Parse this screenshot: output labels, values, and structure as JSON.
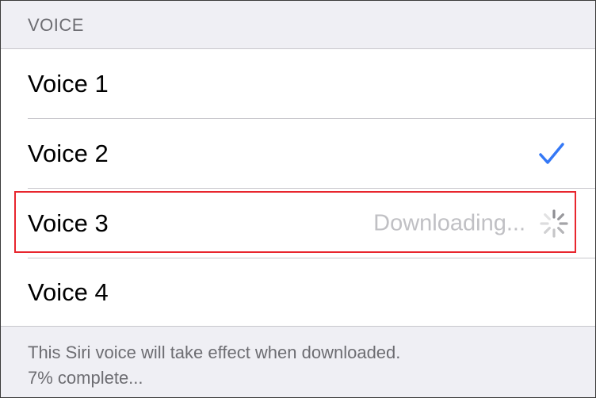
{
  "section": {
    "title": "VOICE"
  },
  "voices": [
    {
      "label": "Voice 1",
      "state": "none"
    },
    {
      "label": "Voice 2",
      "state": "selected",
      "icon": "checkmark-icon"
    },
    {
      "label": "Voice 3",
      "state": "downloading",
      "status": "Downloading...",
      "icon": "spinner-icon"
    },
    {
      "label": "Voice 4",
      "state": "none"
    }
  ],
  "footer": {
    "line1": "This Siri voice will take effect when downloaded.",
    "line2": "7% complete..."
  },
  "colors": {
    "accent": "#3478f6",
    "highlight_outline": "#e8262e",
    "background": "#efeff4",
    "secondary_text": "#6d6d72"
  }
}
